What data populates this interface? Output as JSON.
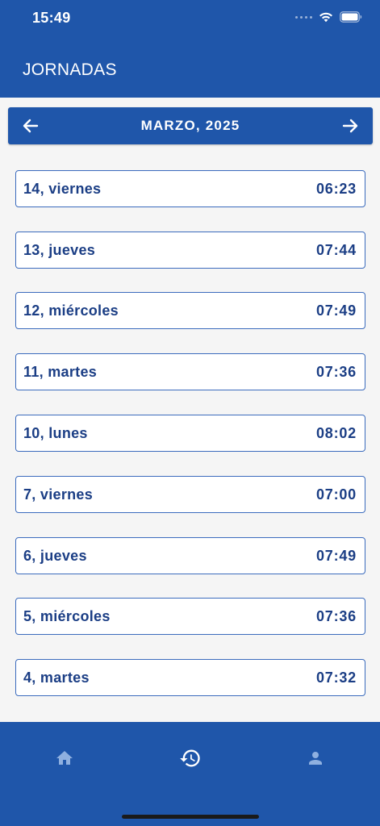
{
  "status_bar": {
    "time": "15:49"
  },
  "header": {
    "title": "JORNADAS"
  },
  "month_nav": {
    "label": "MARZO, 2025",
    "prev_icon": "arrow-left-icon",
    "next_icon": "arrow-right-icon"
  },
  "days": [
    {
      "label": "14, viernes",
      "time": "06:23"
    },
    {
      "label": "13, jueves",
      "time": "07:44"
    },
    {
      "label": "12, miércoles",
      "time": "07:49"
    },
    {
      "label": "11, martes",
      "time": "07:36"
    },
    {
      "label": "10, lunes",
      "time": "08:02"
    },
    {
      "label": "7, viernes",
      "time": "07:00"
    },
    {
      "label": "6, jueves",
      "time": "07:49"
    },
    {
      "label": "5, miércoles",
      "time": "07:36"
    },
    {
      "label": "4, martes",
      "time": "07:32"
    }
  ],
  "tab_bar": {
    "tabs": [
      {
        "icon": "home-icon",
        "active": false
      },
      {
        "icon": "history-icon",
        "active": true
      },
      {
        "icon": "person-icon",
        "active": false
      }
    ]
  },
  "colors": {
    "primary": "#1f56aa",
    "row_border": "#3b6bbd",
    "row_text": "#1b3e85",
    "background": "#f5f5f5",
    "inactive_tab_icon": "#8fb0e0",
    "active_tab_icon": "#ffffff"
  }
}
